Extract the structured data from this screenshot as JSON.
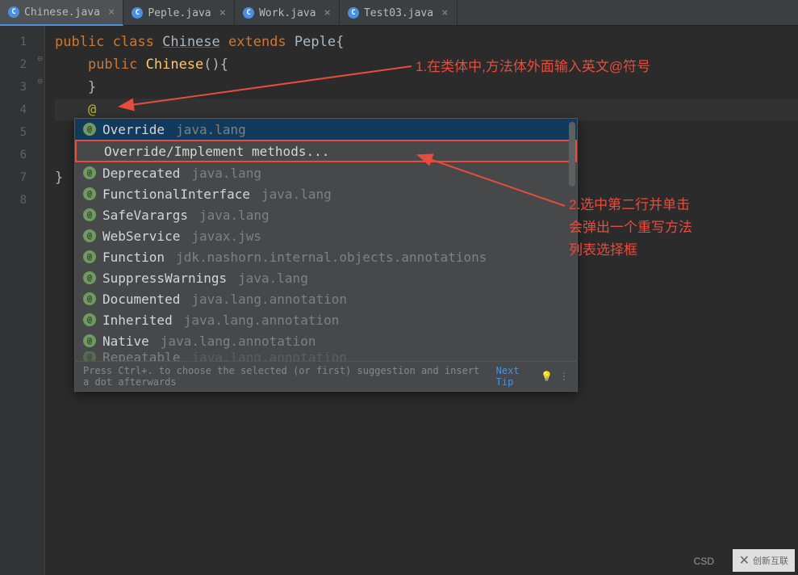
{
  "tabs": [
    {
      "label": "Chinese.java",
      "active": true
    },
    {
      "label": "Peple.java",
      "active": false
    },
    {
      "label": "Work.java",
      "active": false
    },
    {
      "label": "Test03.java",
      "active": false
    }
  ],
  "lines": [
    "1",
    "2",
    "3",
    "4",
    "5",
    "6",
    "7",
    "8"
  ],
  "code": {
    "l1_kw1": "public",
    "l1_kw2": "class",
    "l1_cls": "Chinese",
    "l1_kw3": "extends",
    "l1_parent": "Peple",
    "l1_brace": "{",
    "l2_kw": "public",
    "l2_method": "Chinese",
    "l2_parens": "()",
    "l2_brace": "{",
    "l3_brace": "}",
    "l4_at": "@",
    "l7_brace": "}"
  },
  "popup": {
    "items": [
      {
        "name": "Override",
        "pkg": "java.lang",
        "selected": true,
        "hasIcon": true
      },
      {
        "name": "Override/Implement methods...",
        "pkg": "",
        "highlighted": true,
        "hasIcon": false
      },
      {
        "name": "Deprecated",
        "pkg": "java.lang",
        "hasIcon": true
      },
      {
        "name": "FunctionalInterface",
        "pkg": "java.lang",
        "hasIcon": true
      },
      {
        "name": "SafeVarargs",
        "pkg": "java.lang",
        "hasIcon": true
      },
      {
        "name": "WebService",
        "pkg": "javax.jws",
        "hasIcon": true
      },
      {
        "name": "Function",
        "pkg": "jdk.nashorn.internal.objects.annotations",
        "hasIcon": true
      },
      {
        "name": "SuppressWarnings",
        "pkg": "java.lang",
        "hasIcon": true
      },
      {
        "name": "Documented",
        "pkg": "java.lang.annotation",
        "hasIcon": true
      },
      {
        "name": "Inherited",
        "pkg": "java.lang.annotation",
        "hasIcon": true
      },
      {
        "name": "Native",
        "pkg": "java.lang.annotation",
        "hasIcon": true
      },
      {
        "name": "Repeatable",
        "pkg": "java.lang.annotation",
        "hasIcon": true,
        "faded": true
      }
    ],
    "footer_hint": "Press Ctrl+. to choose the selected (or first) suggestion and insert a dot afterwards",
    "next_tip": "Next Tip"
  },
  "annotations": {
    "a1": "1.在类体中,方法体外面输入英文@符号",
    "a2_l1": "2.选中第二行并单击",
    "a2_l2": "会弹出一个重写方法",
    "a2_l3": "列表选择框"
  },
  "watermark": "创新互联",
  "csd": "CSD"
}
